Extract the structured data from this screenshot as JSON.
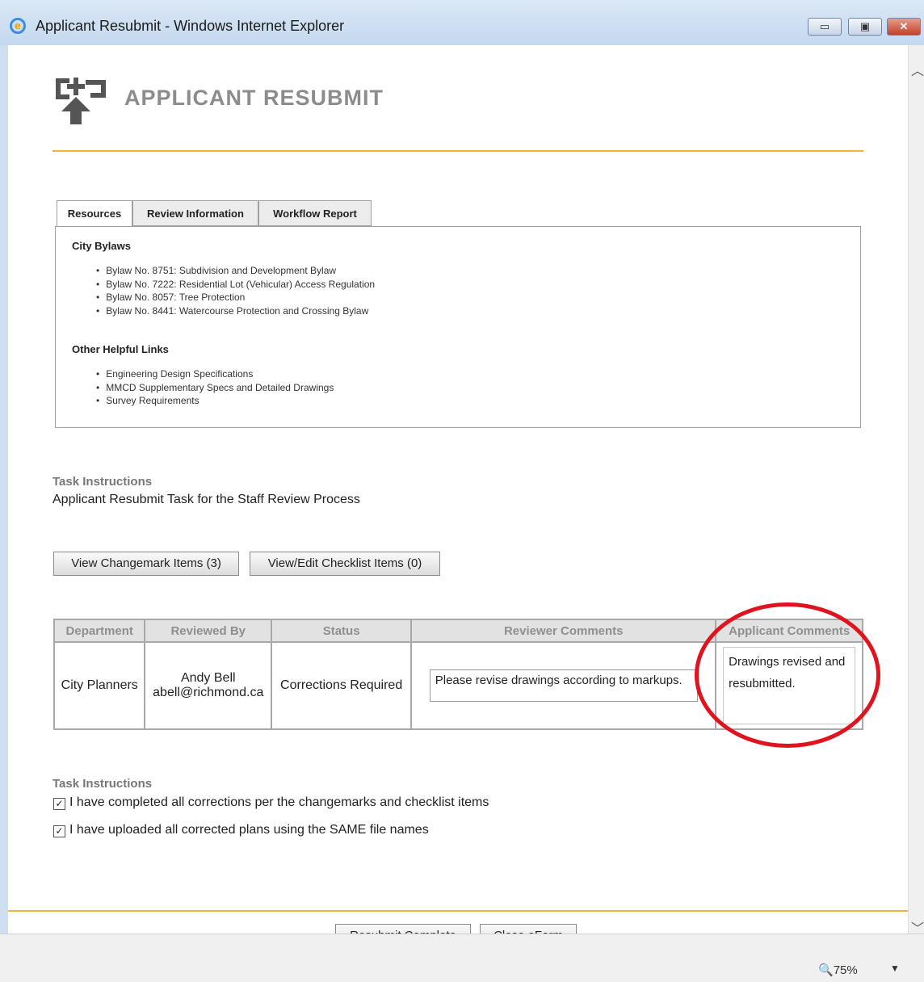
{
  "window": {
    "title": "Applicant Resubmit - Windows Internet Explorer",
    "minimize": "▭",
    "restore": "▣",
    "close": "✕"
  },
  "header": {
    "title": "APPLICANT RESUBMIT"
  },
  "tabs": [
    {
      "label": "Resources",
      "active": true
    },
    {
      "label": "Review Information",
      "active": false
    },
    {
      "label": "Workflow Report",
      "active": false
    }
  ],
  "resources": {
    "bylaws_heading": "City Bylaws",
    "bylaws": [
      "Bylaw No. 8751: Subdivision and Development Bylaw",
      "Bylaw No. 7222: Residential Lot (Vehicular) Access Regulation",
      "Bylaw No. 8057: Tree Protection",
      "Bylaw No. 8441: Watercourse Protection and Crossing Bylaw"
    ],
    "links_heading": "Other Helpful Links",
    "links": [
      "Engineering Design Specifications",
      "MMCD Supplementary Specs and Detailed Drawings",
      "Survey Requirements"
    ]
  },
  "task": {
    "heading": "Task Instructions",
    "description": "Applicant Resubmit Task for the Staff Review Process"
  },
  "buttons": {
    "view_changemark": "View Changemark Items (3)",
    "view_checklist": "View/Edit Checklist Items (0)",
    "resubmit": "Resubmit Complete",
    "close": "Close eForm"
  },
  "review_table": {
    "headers": [
      "Department",
      "Reviewed By",
      "Status",
      "Reviewer Comments",
      "Applicant Comments"
    ],
    "row": {
      "department": "City Planners",
      "reviewer_name": "Andy Bell",
      "reviewer_email": "abell@richmond.ca",
      "status": "Corrections Required",
      "reviewer_comment": "Please revise drawings according to markups.",
      "applicant_comment": "Drawings revised and resubmitted."
    }
  },
  "task2": {
    "heading": "Task Instructions",
    "checks": [
      {
        "label": "I have completed all corrections per the changemarks and checklist items",
        "checked": true
      },
      {
        "label": "I have uploaded all corrected plans using the SAME file names",
        "checked": true
      }
    ]
  },
  "statusbar": {
    "zoom": "75%"
  },
  "colors": {
    "accent_rule": "#f0b43c",
    "highlight_ellipse": "#e0141e"
  }
}
